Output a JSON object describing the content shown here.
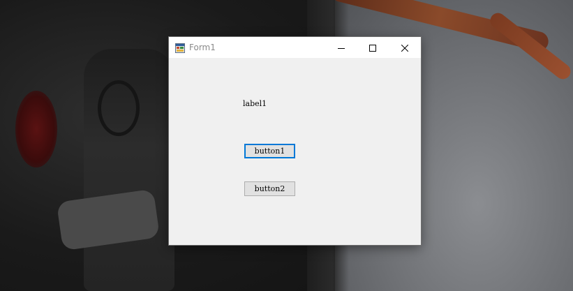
{
  "window": {
    "title": "Form1",
    "icon": "windows-form-icon",
    "caption_buttons": {
      "minimize": "minimize-icon",
      "maximize": "maximize-icon",
      "close": "close-icon"
    }
  },
  "form": {
    "label1": "label1",
    "button1": "button1",
    "button2": "button2",
    "focused_button": "button1"
  },
  "colors": {
    "focus_border": "#0078d7",
    "form_background": "#f0f0f0",
    "button_face": "#e1e1e1"
  }
}
